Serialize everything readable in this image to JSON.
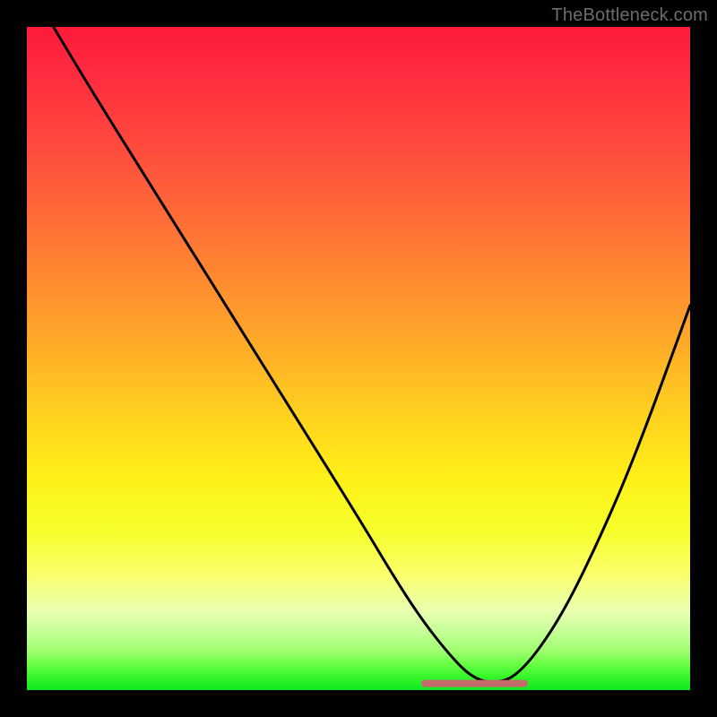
{
  "watermark": "TheBottleneck.com",
  "chart_data": {
    "type": "line",
    "title": "",
    "xlabel": "",
    "ylabel": "",
    "xlim": [
      0,
      100
    ],
    "ylim": [
      0,
      100
    ],
    "grid": false,
    "series": [
      {
        "name": "curve",
        "color": "#000000",
        "x": [
          4,
          10,
          20,
          30,
          40,
          50,
          56,
          60,
          64,
          67,
          70,
          74,
          80,
          86,
          92,
          100
        ],
        "y": [
          100,
          90,
          74,
          58,
          42,
          26,
          16,
          10,
          5,
          2,
          1,
          2,
          10,
          22,
          36,
          58
        ]
      }
    ],
    "annotations": [
      {
        "name": "floor-segment",
        "type": "line",
        "color": "#c46a6a",
        "x": [
          60,
          75
        ],
        "y": [
          1,
          1
        ],
        "stroke_width": 8
      }
    ]
  }
}
